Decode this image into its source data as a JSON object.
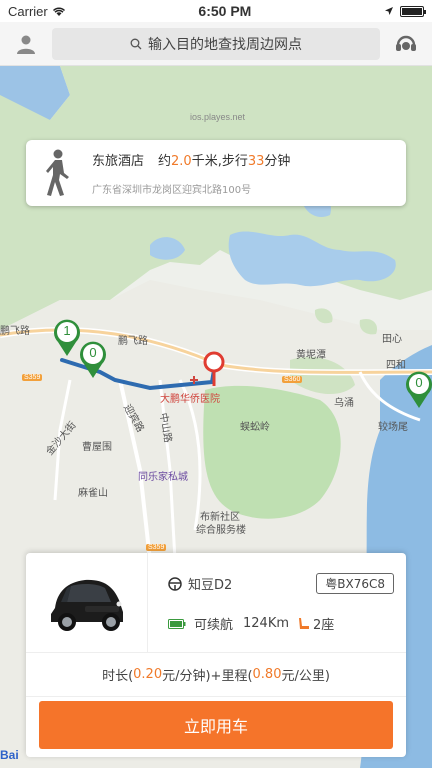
{
  "status_bar": {
    "carrier": "Carrier",
    "time": "6:50 PM",
    "battery_level": 1.0
  },
  "top_bar": {
    "profile_icon": "person-icon",
    "search_placeholder": "输入目的地查找周边网点",
    "service_icon": "headset-icon"
  },
  "watermark": "ios.playes.net",
  "walk_card": {
    "place_name": "东旅酒店",
    "distance_prefix": "约",
    "distance_value": "2.0",
    "distance_unit": "千米,步行",
    "time_value": "33",
    "time_unit": "分钟",
    "address": "广东省深圳市龙岗区迎宾北路100号"
  },
  "map": {
    "labels": {
      "road_pengfei": "鹏飞路",
      "road_pengfei_left": "鹏飞路",
      "huangnitan": "黄坭潭",
      "tianxin": "田心",
      "sihe": "四和",
      "hospital": "大鹏华侨医院",
      "yibinlu": "迎宾路",
      "zhongshanlu": "中山路",
      "jinshadajie": "金沙大街",
      "caowuwei": "曹屋围",
      "tongle": "同乐家私城",
      "maqueshan": "麻雀山",
      "wuyongling": "蜈蚣岭",
      "buxin": "布新社区",
      "buxin2": "综合服务楼",
      "wuyong": "乌涌",
      "jiaoyongwei": "较场尾",
      "baidu": "Bai"
    },
    "road_tags": [
      "S359",
      "S360",
      "S359"
    ],
    "markers": [
      "1",
      "0",
      "0"
    ]
  },
  "car_panel": {
    "model": "知豆D2",
    "plate": "粤BX76C8",
    "range_label": "可续航",
    "range_value": "124Km",
    "seats": "2座",
    "price_text": {
      "time_prefix": "时长(",
      "time_price": "0.20",
      "time_unit": "元/分钟)+里程(",
      "mile_price": "0.80",
      "mile_unit": "元/公里)"
    },
    "use_button": "立即用车"
  }
}
